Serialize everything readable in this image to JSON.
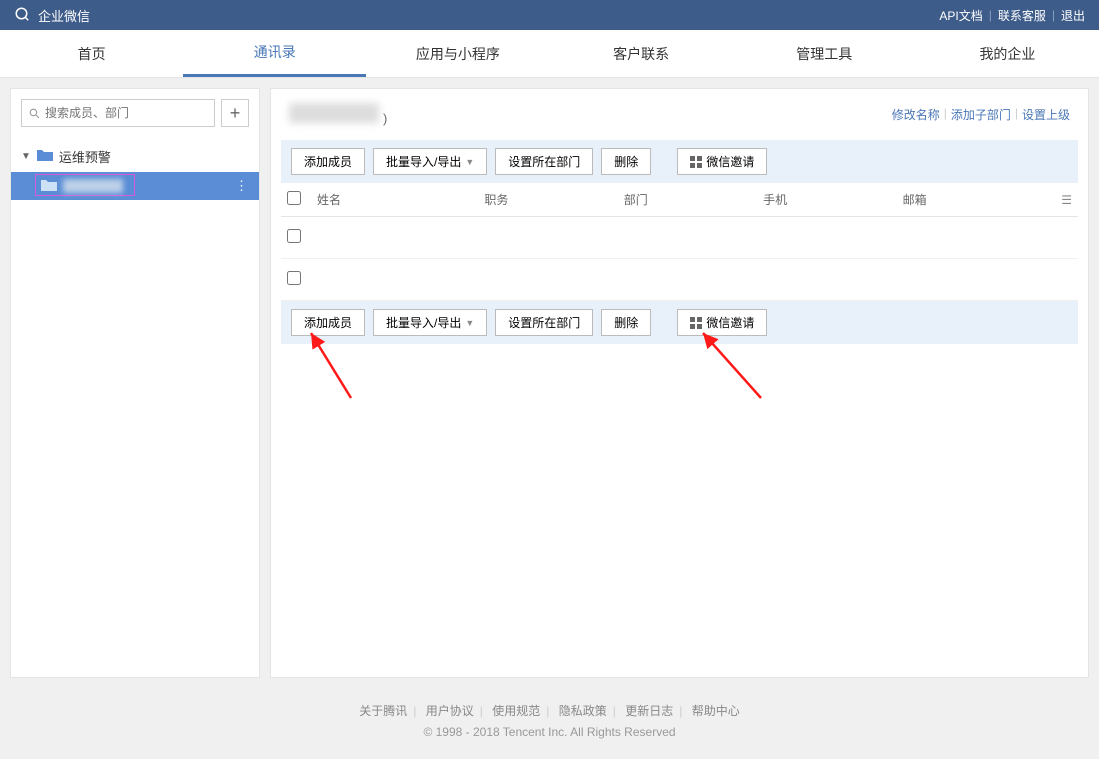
{
  "header": {
    "brand": "企业微信",
    "links": {
      "api": "API文档",
      "support": "联系客服",
      "logout": "退出"
    }
  },
  "nav": {
    "items": [
      "首页",
      "通讯录",
      "应用与小程序",
      "客户联系",
      "管理工具",
      "我的企业"
    ],
    "activeIndex": 1
  },
  "sidebar": {
    "search_placeholder": "搜索成员、部门",
    "root_label": "运维预警"
  },
  "dept": {
    "paren_suffix": ")",
    "actions": {
      "rename": "修改名称",
      "add_sub": "添加子部门",
      "set_superior": "设置上级"
    }
  },
  "toolbar": {
    "add_member": "添加成员",
    "batch": "批量导入/导出",
    "set_dept": "设置所在部门",
    "delete": "删除",
    "wx_invite": "微信邀请"
  },
  "table": {
    "cols": {
      "name": "姓名",
      "job": "职务",
      "dept": "部门",
      "phone": "手机",
      "email": "邮箱"
    }
  },
  "footer": {
    "links": [
      "关于腾讯",
      "用户协议",
      "使用规范",
      "隐私政策",
      "更新日志",
      "帮助中心"
    ],
    "copyright": "© 1998 - 2018 Tencent Inc. All Rights Reserved"
  }
}
